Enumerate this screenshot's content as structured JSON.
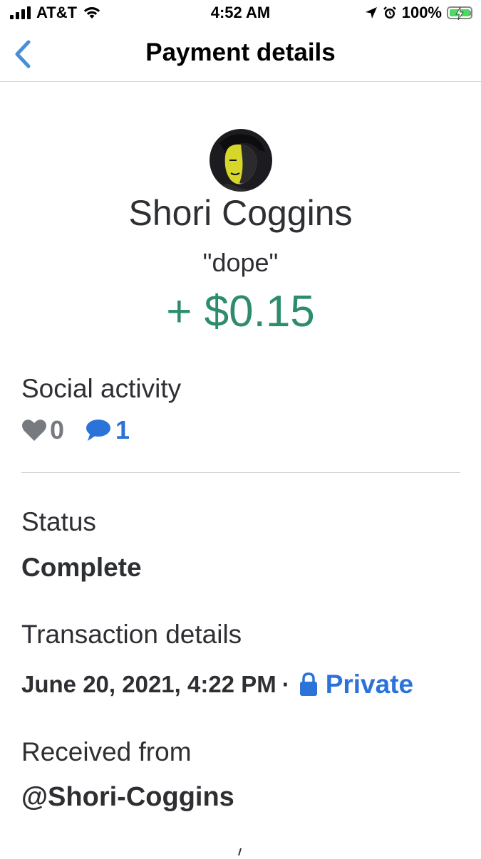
{
  "status_bar": {
    "carrier": "AT&T",
    "time": "4:52 AM",
    "battery": "100%",
    "battery_level": 1.0,
    "icons": [
      "signal-icon",
      "wifi-icon",
      "location-icon",
      "alarm-icon",
      "battery-icon"
    ]
  },
  "nav": {
    "back_icon": "chevron-left-icon",
    "title": "Payment details"
  },
  "payment": {
    "name": "Shori Coggins",
    "note": "\"dope\"",
    "amount": "+ $0.15"
  },
  "social": {
    "label": "Social activity",
    "likes": "0",
    "comments": "1"
  },
  "status": {
    "label": "Status",
    "value": "Complete"
  },
  "transaction": {
    "label": "Transaction details",
    "date": "June 20, 2021, 4:22 PM",
    "separator": "·",
    "privacy": "Private"
  },
  "received": {
    "label": "Received from",
    "handle": "@Shori-Coggins"
  },
  "colors": {
    "amount_green": "#2d8c6e",
    "link_blue": "#2b73d8",
    "text_dark": "#2d2f33",
    "muted_gray": "#777b80",
    "back_blue": "#4a8ed6"
  }
}
